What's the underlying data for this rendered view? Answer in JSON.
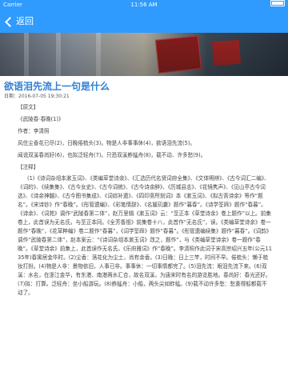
{
  "status_bar": {
    "carrier": "Carrier",
    "time": "11:56 AM"
  },
  "nav": {
    "back_label": "返回"
  },
  "article": {
    "title": "欲语泪先流上一句是什么",
    "date": "日期：2016-07-05 19:30:21",
    "original_tag": "【原文】",
    "poem_title": "《武陵春·春晚(1)》",
    "author": "作者：李清照",
    "line1": "风住尘香花已尽(2)，日晚倦梳头(3)。物是人非事事休(4)，欲语泪先流(5)。",
    "line2": "闻说双溪春尚好(6)，也拟泛轻舟(7)。只恐双溪舴艋舟(8)，载不动、许多愁(9)。",
    "notes_tag": "【注释】",
    "notes_body": "(1)《诗词杂俎本漱玉词》、《类编草堂诗余》、《汇选历代名贤词府全集》、《文体明辨》、《古今词汇二编》、《词的》、《续集集》、《古今女史》、《古今词统》、《古今诗余醉》、《历城县志》、《花镜隽声》、《见山亭古今词选》、《诗余神髓》、《古今图书集成》、《词综补遗》、《四印斋所刻词》本《漱玉词》、《拟古斋诗余》等作“题名”。《宋诗钞》作“春晚”。《彤管遗编》、《彩笔情辞》、《名媛玑囊》题作“暮春”。《诗学筌蹄》题作“春暮”。《诗余》、《词苑》调作“武陵春第二体”，赵万里辑《漱玉词》云：“至正本《草堂诗余》卷上题作”以上。前集卷上，此首误为无名氏，与至正本同。《全芳备祖》前集卷十八，此首作“无名氏”，误。《类编草堂诗余》卷一题作“春晚”，《花草粹编》卷二题作“春暮”，《词学筌蹄》题作“春暮”。《彤管遗编续集》题作“暮春”。《词韵》调作“武陵春第二体”，赵本案云：“《诗词杂俎本漱玉词》改之，题作”，与《类编草堂诗余》卷一题作“春晚”。《草堂诗余》前集上，此首误作无名氏。《乐府雅词》作“春晚”。李清照作此词于宋高宗绍兴五年(公元1135年)春寓居金华时。(2)尘香：落花化为尘土，尚有余香。(3)日晚：日上三竿，时间不早。倦梳头：懒于梳妆打扮。(4)物是人非：景物依旧，人事已非。事事休：一切事情都完了。(5)泪先流：眼泪先流下来。(6)双溪：水名，在浙江金华，有东港、南港两水汇合，故名双溪，为唐宋时有名的游览胜地。春尚好：春光还好。(7)拟：打算。泛轻舟：坐小船游玩。(8)舴艋舟：小船，两头尖如蚱蜢。(9)载不动许多愁：愁重得船都载不动了。"
  }
}
